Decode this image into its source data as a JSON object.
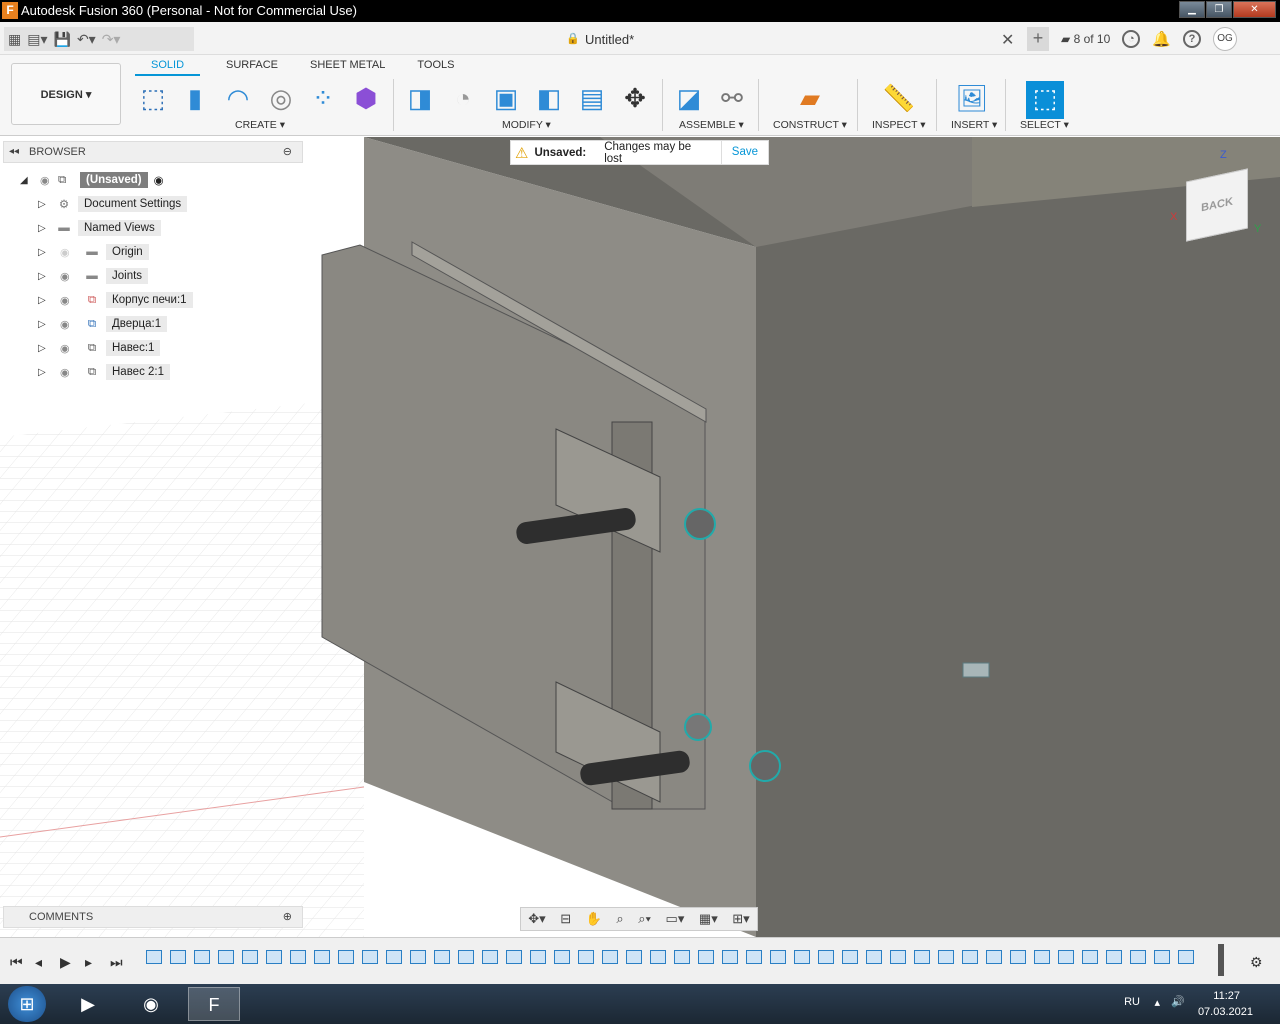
{
  "window": {
    "title": "Autodesk Fusion 360 (Personal - Not for Commercial Use)",
    "app_icon_letter": "F"
  },
  "qat": {
    "doc_title": "Untitled*",
    "jobs": "8 of 10",
    "user_initials": "OG"
  },
  "ribbon": {
    "workspace": "DESIGN ▾",
    "tabs": [
      "SOLID",
      "SURFACE",
      "SHEET METAL",
      "TOOLS"
    ],
    "groups": {
      "create": "CREATE ▾",
      "modify": "MODIFY ▾",
      "assemble": "ASSEMBLE ▾",
      "construct": "CONSTRUCT ▾",
      "inspect": "INSPECT ▾",
      "insert": "INSERT ▾",
      "select": "SELECT ▾"
    }
  },
  "browser": {
    "header": "BROWSER",
    "root": "(Unsaved)",
    "items": [
      {
        "label": "Document Settings",
        "icon": "gear-icon"
      },
      {
        "label": "Named Views",
        "icon": "folder-icon"
      },
      {
        "label": "Origin",
        "icon": "folder-icon"
      },
      {
        "label": "Joints",
        "icon": "folder-icon"
      },
      {
        "label": "Корпус печи:1",
        "icon": "component-icon"
      },
      {
        "label": "Дверца:1",
        "icon": "component-icon"
      },
      {
        "label": "Навес:1",
        "icon": "component-icon"
      },
      {
        "label": "Навес 2:1",
        "icon": "component-icon"
      }
    ]
  },
  "notice": {
    "title": "Unsaved:",
    "message": "Changes may be lost",
    "action": "Save"
  },
  "comments": {
    "header": "COMMENTS"
  },
  "viewcube": {
    "face": "BACK",
    "axes": [
      "Z",
      "X",
      "Y"
    ]
  },
  "taskbar": {
    "lang": "RU",
    "time": "11:27",
    "date": "07.03.2021"
  },
  "colors": {
    "accent": "#0696d7",
    "model_light": "#8d8b84",
    "model_dark": "#5f5e5a"
  }
}
